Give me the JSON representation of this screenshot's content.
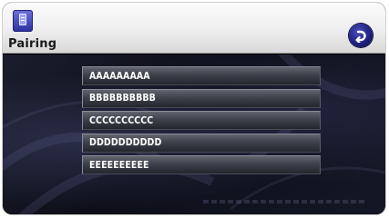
{
  "header": {
    "title": "Pairing",
    "app_icon": "phone-icon",
    "back_icon": "back-arrow-icon"
  },
  "colors": {
    "header_bg": "#eeeeee",
    "panel_bg": "#0d0e18",
    "accent": "#1f2280",
    "item_text": "#ffffff"
  },
  "devices": [
    {
      "label": "AAAAAAAAA"
    },
    {
      "label": "BBBBBBBBBB"
    },
    {
      "label": "CCCCCCCCCC"
    },
    {
      "label": "DDDDDDDDDD"
    },
    {
      "label": "EEEEEEEEEE"
    }
  ]
}
